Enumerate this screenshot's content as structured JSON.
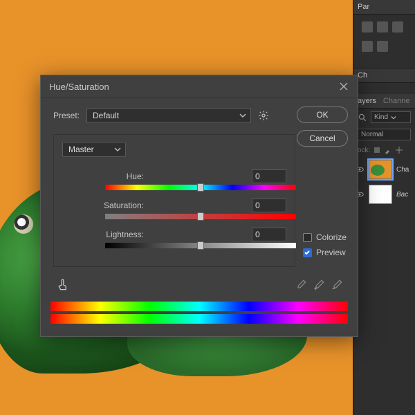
{
  "dialog": {
    "title": "Hue/Saturation",
    "preset_label": "Preset:",
    "preset_value": "Default",
    "ok_label": "OK",
    "cancel_label": "Cancel",
    "channel_value": "Master",
    "sliders": {
      "hue": {
        "label": "Hue:",
        "value": "0"
      },
      "saturation": {
        "label": "Saturation:",
        "value": "0"
      },
      "lightness": {
        "label": "Lightness:",
        "value": "0"
      }
    },
    "colorize_label": "Colorize",
    "colorize_checked": false,
    "preview_label": "Preview",
    "preview_checked": true
  },
  "panels": {
    "top_tab": "Par",
    "ch_tab": "Ch",
    "layers_tabs": {
      "layers": "ayers",
      "channels": "Channe"
    },
    "kind_label": "Kind",
    "blend_mode": "Normal",
    "lock_label": "ock:",
    "layer1_name": "Cha",
    "layer2_name": "Bac"
  }
}
